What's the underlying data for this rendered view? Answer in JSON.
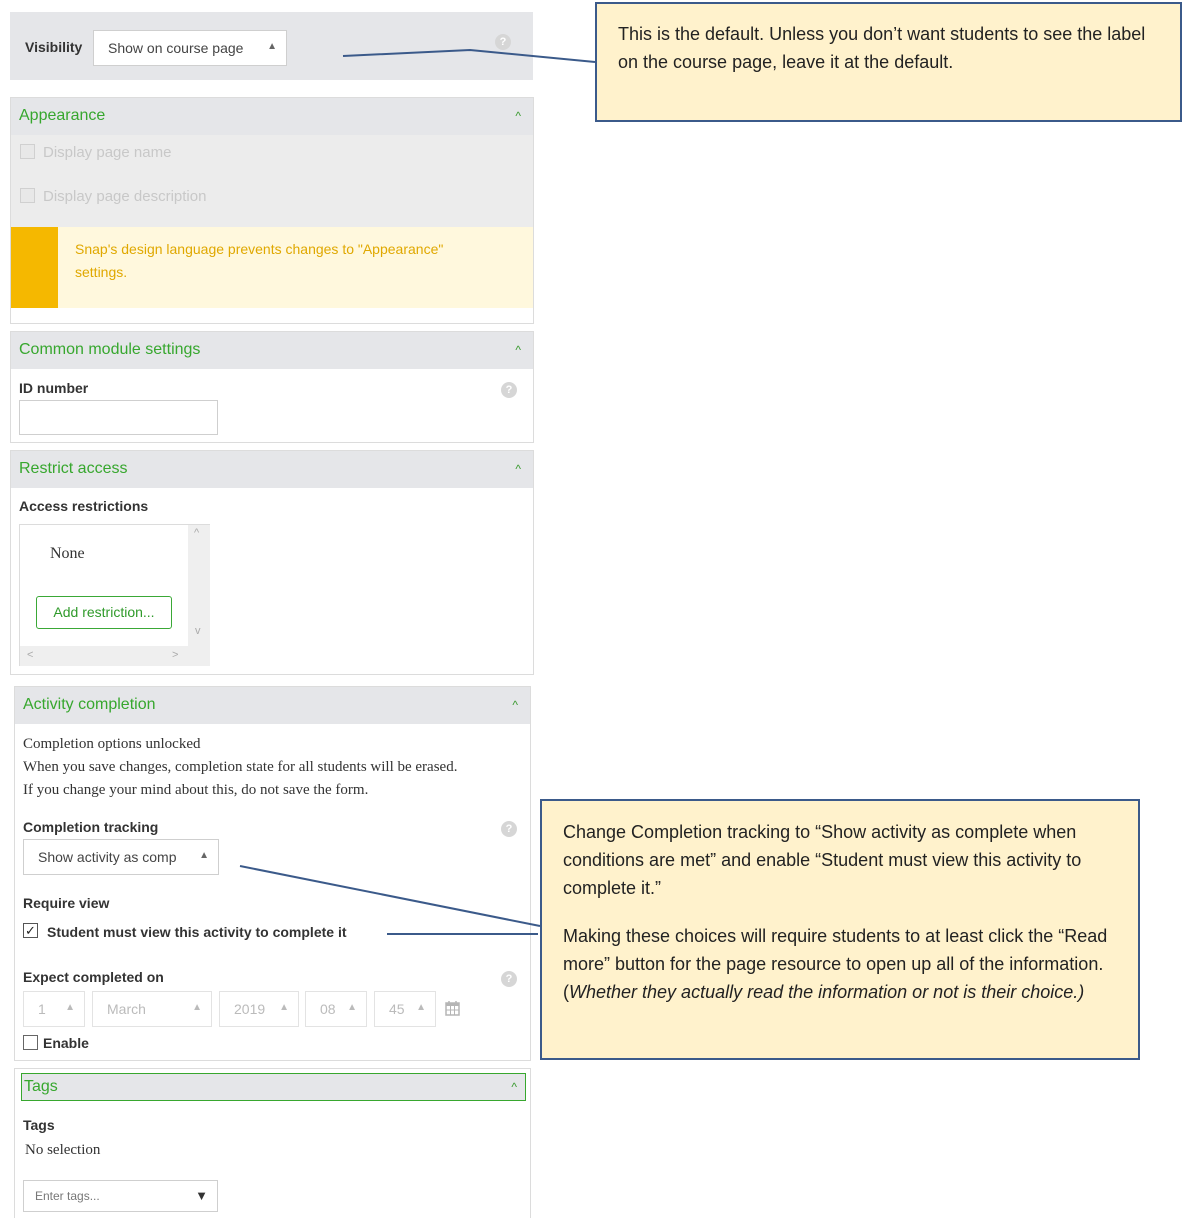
{
  "visibility": {
    "label": "Visibility",
    "value": "Show on course page",
    "help": "?"
  },
  "callout_top": {
    "text": "This is the default. Unless you don’t want students to see the label on the course page, leave it at the default."
  },
  "appearance": {
    "title": "Appearance",
    "chevron": "^",
    "display_name": "Display page name",
    "display_description": "Display page description",
    "warning": "Snap's design language prevents changes to \"Appearance\" settings."
  },
  "common": {
    "title": "Common module settings",
    "chevron": "^",
    "id_label": "ID number",
    "id_value": "",
    "help": "?"
  },
  "restrict": {
    "title": "Restrict access",
    "chevron": "^",
    "label": "Access restrictions",
    "none": "None",
    "add_button": "Add restriction...",
    "scroll_up": "^",
    "scroll_down": "v",
    "scroll_left": "<",
    "scroll_right": ">"
  },
  "completion": {
    "title": "Activity completion",
    "chevron": "^",
    "unlocked": "Completion options unlocked",
    "notice1": "When you save changes, completion state for all students will be erased.",
    "notice2": "If you change your mind about this, do not save the form.",
    "tracking_label": "Completion tracking",
    "tracking_value": "Show activity as comp",
    "require_view_label": "Require view",
    "require_view_check": "Student must view this activity to complete it",
    "expect_label": "Expect completed on",
    "day": "1",
    "month": "March",
    "year": "2019",
    "hour": "08",
    "minute": "45",
    "enable": "Enable",
    "help": "?",
    "require_view_checked": true,
    "enable_checked": false
  },
  "callout_bottom": {
    "para1": "Change Completion tracking to “Show activity as complete when conditions are met” and enable “Student must view this activity to complete it.”",
    "para2_start": "Making these choices will require students to at least click the “Read more” button for the page resource to open up all of the information. (",
    "para2_italic": "Whether they actually read the information or not is their choice.)"
  },
  "tags": {
    "title": "Tags",
    "chevron": "^",
    "label": "Tags",
    "none": "No selection",
    "placeholder": "Enter tags..."
  },
  "colors": {
    "accent_green": "#37a72e",
    "warning_bar": "#f5b800",
    "warning_text": "#e0a800",
    "callout_bg": "#fff2cc",
    "callout_border": "#3b5a8a"
  }
}
